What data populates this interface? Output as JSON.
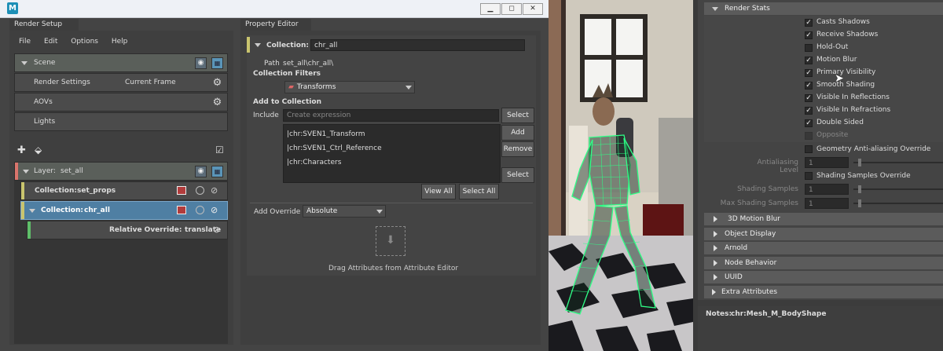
{
  "window": {
    "app_icon": "M",
    "controls": [
      "minimize-icon",
      "restore-icon",
      "close-icon"
    ]
  },
  "render_setup": {
    "tab_label": "Render Setup",
    "menu": [
      "File",
      "Edit",
      "Options",
      "Help"
    ],
    "scene_label": "Scene",
    "render_settings_label": "Render Settings",
    "current_frame_label": "Current Frame",
    "aovs_label": "AOVs",
    "lights_label": "Lights",
    "layer_label": "Layer:",
    "layer_name": "set_all",
    "collection1_label": "Collection:",
    "collection1_name": "set_props",
    "collection2_label": "Collection:",
    "collection2_name": "chr_all",
    "override_label": "Relative Override:",
    "override_name": "translate",
    "colors": {
      "layer_accent": "#d9746c",
      "collection_accent": "#c9c46e",
      "override_accent": "#5fbf6a",
      "selected_row": "#4f7fa3"
    }
  },
  "property_editor": {
    "tab_label": "Property Editor",
    "collection_label": "Collection:",
    "collection_value": "chr_all",
    "path_label": "Path",
    "path_value": "set_all\\chr_all\\",
    "filters_label": "Collection Filters",
    "filter_value": "Transforms",
    "add_to_collection_label": "Add to Collection",
    "include_label": "Include",
    "include_placeholder": "Create expression",
    "select_button": "Select",
    "add_button": "Add",
    "remove_button": "Remove",
    "select_button_2": "Select",
    "members": [
      "|chr:SVEN1_Transform",
      "|chr:SVEN1_Ctrl_Reference",
      "|chr:Characters"
    ],
    "view_all_button": "View All",
    "select_all_button": "Select All",
    "add_override_label": "Add Override",
    "add_override_value": "Absolute",
    "drag_hint": "Drag Attributes from Attribute Editor"
  },
  "attribute_editor": {
    "render_stats_header": "Render Stats",
    "checkboxes": [
      {
        "label": "Casts Shadows",
        "checked": true,
        "enabled": true
      },
      {
        "label": "Receive Shadows",
        "checked": true,
        "enabled": true
      },
      {
        "label": "Hold-Out",
        "checked": false,
        "enabled": true
      },
      {
        "label": "Motion Blur",
        "checked": true,
        "enabled": true
      },
      {
        "label": "Primary Visibility",
        "checked": true,
        "enabled": true
      },
      {
        "label": "Smooth Shading",
        "checked": true,
        "enabled": true
      },
      {
        "label": "Visible In Reflections",
        "checked": true,
        "enabled": true
      },
      {
        "label": "Visible In Refractions",
        "checked": true,
        "enabled": true
      },
      {
        "label": "Double Sided",
        "checked": true,
        "enabled": true
      },
      {
        "label": "Opposite",
        "checked": false,
        "enabled": false
      }
    ],
    "geometry_aa_override": "Geometry Anti-aliasing Override",
    "antialiasing_level_label": "Antialiasing Level",
    "antialiasing_level_value": "1",
    "shading_samples_override": "Shading Samples Override",
    "shading_samples_label": "Shading Samples",
    "shading_samples_value": "1",
    "max_shading_samples_label": "Max Shading Samples",
    "max_shading_samples_value": "1",
    "sections": [
      "3D Motion Blur",
      "Object Display",
      "Arnold",
      "Node Behavior",
      "UUID",
      "Extra Attributes"
    ],
    "notes_label": "Notes:",
    "notes_value": "chr:Mesh_M_BodyShape"
  }
}
